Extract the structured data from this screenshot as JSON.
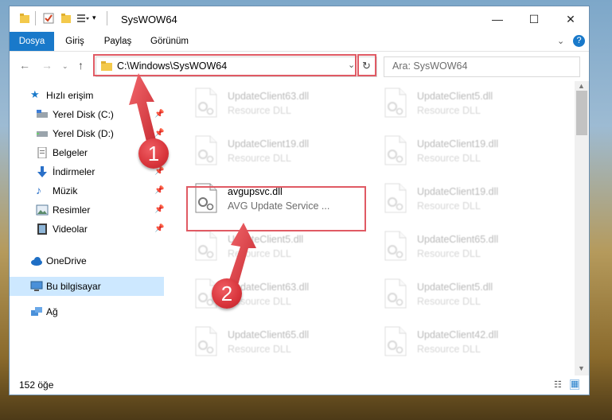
{
  "window": {
    "title": "SysWOW64",
    "controls": {
      "minimize": "—",
      "maximize": "☐",
      "close": "✕"
    }
  },
  "ribbon": {
    "tabs": [
      "Dosya",
      "Giriş",
      "Paylaş",
      "Görünüm"
    ],
    "expand_icon": "chevron-down-icon",
    "help_icon": "?"
  },
  "address": {
    "path": "C:\\Windows\\SysWOW64",
    "search_placeholder": "Ara: SysWOW64"
  },
  "nav": {
    "quick_access": "Hızlı erişim",
    "items": [
      {
        "label": "Yerel Disk (C:)",
        "icon": "drive-icon",
        "pinned": true
      },
      {
        "label": "Yerel Disk (D:)",
        "icon": "drive-icon",
        "pinned": true
      },
      {
        "label": "Belgeler",
        "icon": "documents-icon",
        "pinned": true
      },
      {
        "label": "İndirmeler",
        "icon": "download-icon",
        "pinned": true
      },
      {
        "label": "Müzik",
        "icon": "music-icon",
        "pinned": true
      },
      {
        "label": "Resimler",
        "icon": "pictures-icon",
        "pinned": true
      },
      {
        "label": "Videolar",
        "icon": "videos-icon",
        "pinned": true
      }
    ],
    "onedrive": "OneDrive",
    "this_pc": "Bu bilgisayar",
    "network": "Ağ"
  },
  "files": {
    "highlighted": {
      "name": "avgupsvc.dll",
      "desc": "AVG Update Service ..."
    },
    "left_column": [
      {
        "name": "UpdateClient63.dll",
        "desc": "Resource DLL"
      },
      {
        "name": "UpdateClient19.dll",
        "desc": "Resource DLL"
      },
      {
        "name": "UpdateClient5.dll",
        "desc": "Resource DLL"
      },
      {
        "name": "UpdateClient63.dll",
        "desc": "Resource DLL"
      },
      {
        "name": "UpdateClient65.dll",
        "desc": "Resource DLL"
      }
    ],
    "right_column": [
      {
        "name": "UpdateClient5.dll",
        "desc": "Resource DLL"
      },
      {
        "name": "UpdateClient19.dll",
        "desc": "Resource DLL"
      },
      {
        "name": "UpdateClient19.dll",
        "desc": "Resource DLL"
      },
      {
        "name": "UpdateClient65.dll",
        "desc": "Resource DLL"
      },
      {
        "name": "UpdateClient5.dll",
        "desc": "Resource DLL"
      },
      {
        "name": "UpdateClient42.dll",
        "desc": "Resource DLL"
      }
    ]
  },
  "status": {
    "count": "152 öğe"
  },
  "callouts": {
    "step1": "1",
    "step2": "2"
  },
  "colors": {
    "accent": "#1979ca",
    "highlight": "#e05a64",
    "selection": "#cde8ff"
  }
}
